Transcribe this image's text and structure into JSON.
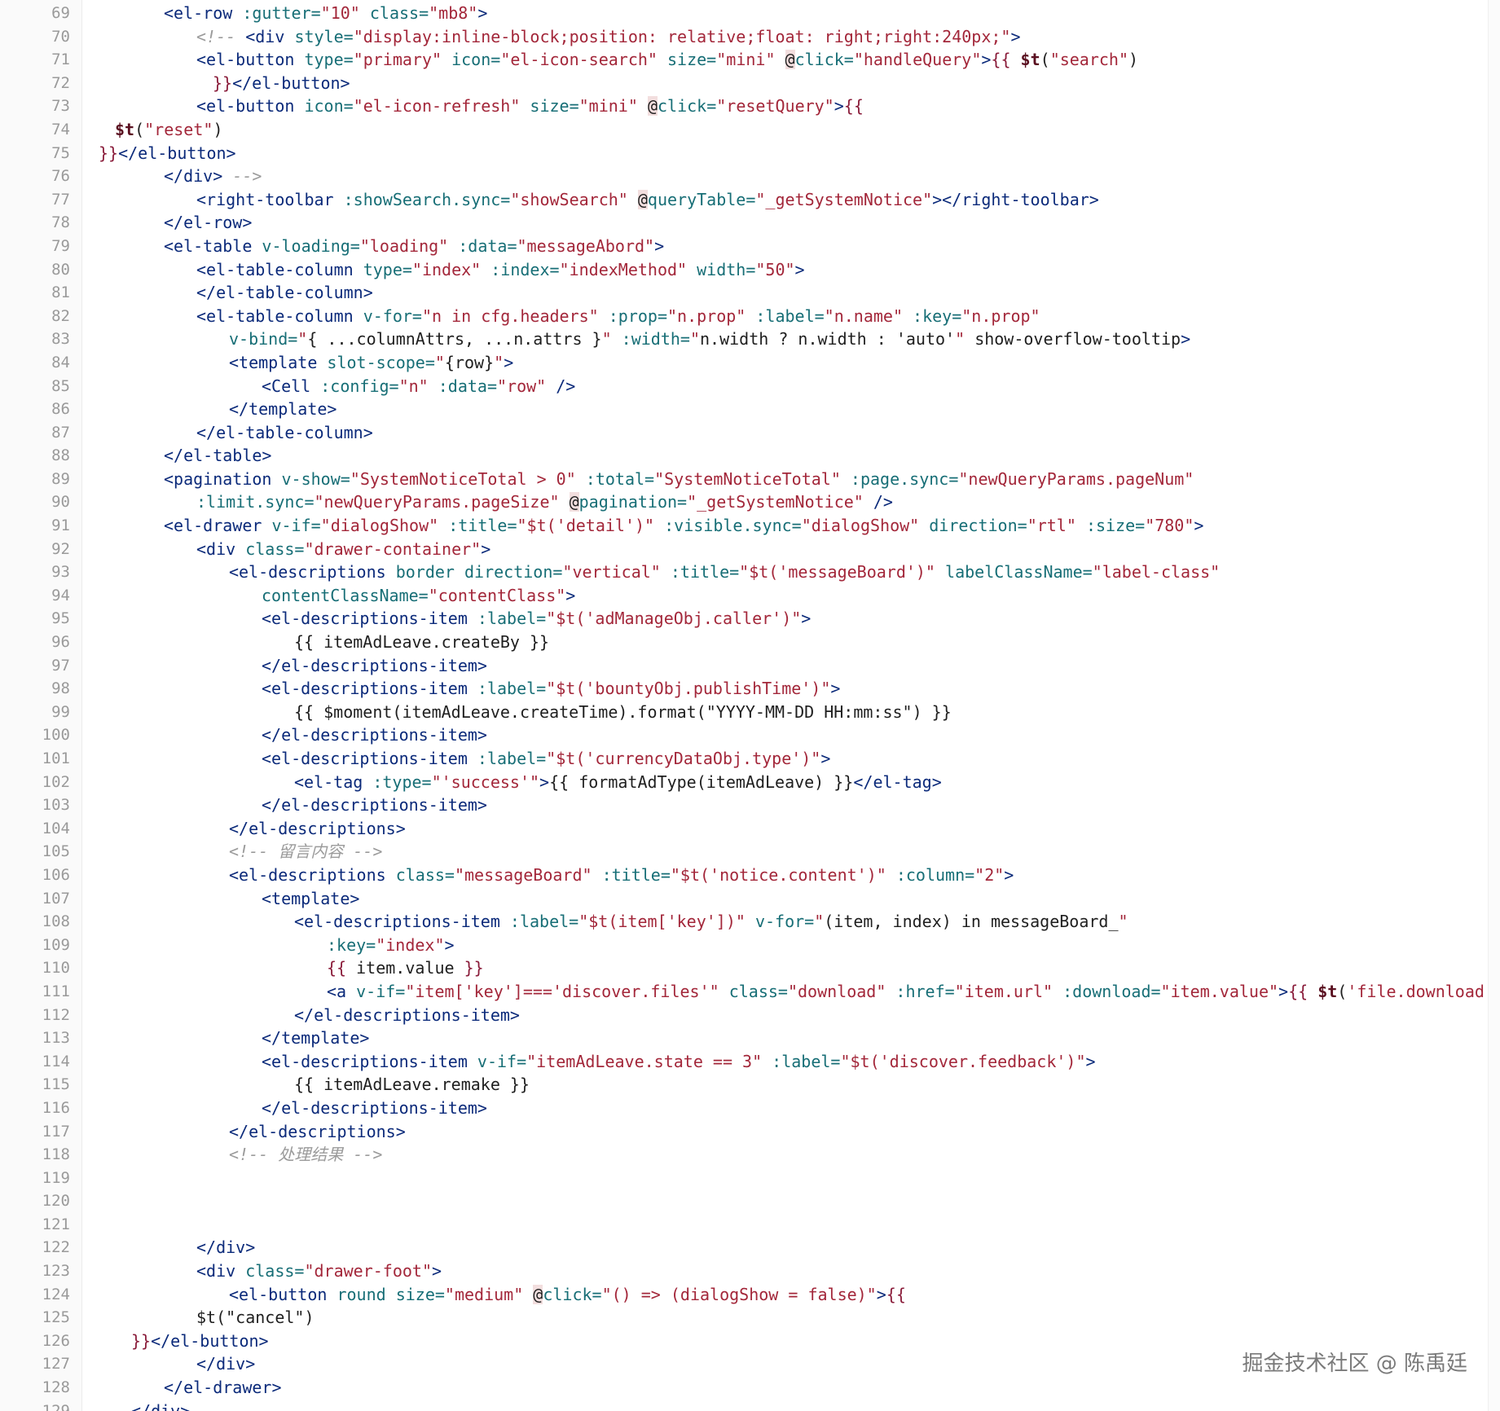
{
  "watermark": "掘金技术社区 @ 陈禹廷",
  "lines": [
    {
      "n": "69",
      "indent": 12,
      "toks": [
        [
          "tag",
          "<el-row "
        ],
        [
          "attr",
          ":gutter="
        ],
        [
          "str",
          "\"10\" "
        ],
        [
          "attr",
          "class="
        ],
        [
          "str",
          "\"mb8\""
        ],
        [
          "tag",
          ">"
        ]
      ]
    },
    {
      "n": "70",
      "indent": 16,
      "toks": [
        [
          "com",
          "<!-- "
        ],
        [
          "tag",
          "<div "
        ],
        [
          "attr",
          "style="
        ],
        [
          "str",
          "\"display:inline-block;position: relative;float: right;right:240px;\""
        ],
        [
          "tag",
          ">"
        ]
      ]
    },
    {
      "n": "71",
      "indent": 16,
      "toks": [
        [
          "tag",
          "<el-button "
        ],
        [
          "attr",
          "type="
        ],
        [
          "str",
          "\"primary\" "
        ],
        [
          "attr",
          "icon="
        ],
        [
          "str",
          "\"el-icon-search\" "
        ],
        [
          "attr",
          "size="
        ],
        [
          "str",
          "\"mini\" "
        ],
        [
          "at",
          "@"
        ],
        [
          "attr",
          "click="
        ],
        [
          "str",
          "\"handleQuery\""
        ],
        [
          "tag",
          ">"
        ],
        [
          "brk",
          "{{ "
        ],
        [
          "fn",
          "$t"
        ],
        [
          "txt",
          "("
        ],
        [
          "str",
          "\"search\""
        ],
        [
          "txt",
          ")"
        ]
      ]
    },
    {
      "n": "72",
      "indent": 18,
      "toks": [
        [
          "brk",
          "}}"
        ],
        [
          "tag",
          "</el-button>"
        ]
      ]
    },
    {
      "n": "73",
      "indent": 16,
      "toks": [
        [
          "tag",
          "<el-button "
        ],
        [
          "attr",
          "icon="
        ],
        [
          "str",
          "\"el-icon-refresh\" "
        ],
        [
          "attr",
          "size="
        ],
        [
          "str",
          "\"mini\" "
        ],
        [
          "at",
          "@"
        ],
        [
          "attr",
          "click="
        ],
        [
          "str",
          "\"resetQuery\""
        ],
        [
          "tag",
          ">"
        ],
        [
          "brk",
          "{{"
        ]
      ]
    },
    {
      "n": "74",
      "indent": 6,
      "toks": [
        [
          "fn",
          "$t"
        ],
        [
          "txt",
          "("
        ],
        [
          "str",
          "\"reset\""
        ],
        [
          "txt",
          ")"
        ]
      ]
    },
    {
      "n": "75",
      "indent": 4,
      "toks": [
        [
          "brk",
          "}}"
        ],
        [
          "tag",
          "</el-button>"
        ]
      ]
    },
    {
      "n": "76",
      "indent": 12,
      "toks": [
        [
          "tag",
          "</div> "
        ],
        [
          "com",
          "-->"
        ]
      ]
    },
    {
      "n": "77",
      "indent": 16,
      "toks": [
        [
          "tag",
          "<right-toolbar "
        ],
        [
          "attr",
          ":showSearch.sync="
        ],
        [
          "str",
          "\"showSearch\" "
        ],
        [
          "at",
          "@"
        ],
        [
          "attr",
          "queryTable="
        ],
        [
          "str",
          "\"_getSystemNotice\""
        ],
        [
          "tag",
          "></right-toolbar>"
        ]
      ]
    },
    {
      "n": "78",
      "indent": 12,
      "toks": [
        [
          "tag",
          "</el-row>"
        ]
      ]
    },
    {
      "n": "79",
      "indent": 12,
      "toks": [
        [
          "tag",
          "<el-table "
        ],
        [
          "attr",
          "v-loading="
        ],
        [
          "str",
          "\"loading\" "
        ],
        [
          "attr",
          ":data="
        ],
        [
          "str",
          "\"messageAbord\""
        ],
        [
          "tag",
          ">"
        ]
      ]
    },
    {
      "n": "80",
      "indent": 16,
      "toks": [
        [
          "tag",
          "<el-table-column "
        ],
        [
          "attr",
          "type="
        ],
        [
          "str",
          "\"index\" "
        ],
        [
          "attr",
          ":index="
        ],
        [
          "str",
          "\"indexMethod\" "
        ],
        [
          "attr",
          "width="
        ],
        [
          "str",
          "\"50\""
        ],
        [
          "tag",
          ">"
        ]
      ]
    },
    {
      "n": "81",
      "indent": 16,
      "toks": [
        [
          "tag",
          "</el-table-column>"
        ]
      ]
    },
    {
      "n": "82",
      "indent": 16,
      "toks": [
        [
          "tag",
          "<el-table-column "
        ],
        [
          "attr",
          "v-for="
        ],
        [
          "str",
          "\"n in cfg.headers\" "
        ],
        [
          "attr",
          ":prop="
        ],
        [
          "str",
          "\"n.prop\" "
        ],
        [
          "attr",
          ":label="
        ],
        [
          "str",
          "\"n.name\" "
        ],
        [
          "attr",
          ":key="
        ],
        [
          "str",
          "\"n.prop\""
        ]
      ]
    },
    {
      "n": "83",
      "indent": 20,
      "toks": [
        [
          "attr",
          "v-bind="
        ],
        [
          "str",
          "\""
        ],
        [
          "txt",
          "{ ...columnAttrs, ...n.attrs }"
        ],
        [
          "str",
          "\" "
        ],
        [
          "attr",
          ":width="
        ],
        [
          "str",
          "\""
        ],
        [
          "txt",
          "n.width ? n.width : 'auto'"
        ],
        [
          "str",
          "\" "
        ],
        [
          "txt",
          "show-overflow-tooltip"
        ],
        [
          "tag",
          ">"
        ]
      ]
    },
    {
      "n": "84",
      "indent": 20,
      "toks": [
        [
          "tag",
          "<template "
        ],
        [
          "attr",
          "slot-scope="
        ],
        [
          "str",
          "\""
        ],
        [
          "txt",
          "{row}"
        ],
        [
          "str",
          "\""
        ],
        [
          "tag",
          ">"
        ]
      ]
    },
    {
      "n": "85",
      "indent": 24,
      "toks": [
        [
          "tag",
          "<Cell "
        ],
        [
          "attr",
          ":config="
        ],
        [
          "str",
          "\"n\" "
        ],
        [
          "attr",
          ":data="
        ],
        [
          "str",
          "\"row\" "
        ],
        [
          "tag",
          "/>"
        ]
      ]
    },
    {
      "n": "86",
      "indent": 20,
      "toks": [
        [
          "tag",
          "</template>"
        ]
      ]
    },
    {
      "n": "87",
      "indent": 16,
      "toks": [
        [
          "tag",
          "</el-table-column>"
        ]
      ]
    },
    {
      "n": "88",
      "indent": 12,
      "toks": [
        [
          "tag",
          "</el-table>"
        ]
      ]
    },
    {
      "n": "89",
      "indent": 12,
      "toks": [
        [
          "tag",
          "<pagination "
        ],
        [
          "attr",
          "v-show="
        ],
        [
          "str",
          "\"SystemNoticeTotal > 0\" "
        ],
        [
          "attr",
          ":total="
        ],
        [
          "str",
          "\"SystemNoticeTotal\" "
        ],
        [
          "attr",
          ":page.sync="
        ],
        [
          "str",
          "\"newQueryParams.pageNum\""
        ]
      ]
    },
    {
      "n": "90",
      "indent": 16,
      "toks": [
        [
          "attr",
          ":limit.sync="
        ],
        [
          "str",
          "\"newQueryParams.pageSize\" "
        ],
        [
          "at",
          "@"
        ],
        [
          "attr",
          "pagination="
        ],
        [
          "str",
          "\"_getSystemNotice\" "
        ],
        [
          "tag",
          "/>"
        ]
      ]
    },
    {
      "n": "91",
      "indent": 12,
      "toks": [
        [
          "tag",
          "<el-drawer "
        ],
        [
          "attr",
          "v-if="
        ],
        [
          "str",
          "\"dialogShow\" "
        ],
        [
          "attr",
          ":title="
        ],
        [
          "str",
          "\"$t('detail')\" "
        ],
        [
          "attr",
          ":visible.sync="
        ],
        [
          "str",
          "\"dialogShow\" "
        ],
        [
          "attr",
          "direction="
        ],
        [
          "str",
          "\"rtl\" "
        ],
        [
          "attr",
          ":size="
        ],
        [
          "str",
          "\"780\""
        ],
        [
          "tag",
          ">"
        ]
      ]
    },
    {
      "n": "92",
      "indent": 16,
      "toks": [
        [
          "tag",
          "<div "
        ],
        [
          "attr",
          "class="
        ],
        [
          "str",
          "\"drawer-container\""
        ],
        [
          "tag",
          ">"
        ]
      ]
    },
    {
      "n": "93",
      "indent": 20,
      "toks": [
        [
          "tag",
          "<el-descriptions "
        ],
        [
          "attr",
          "border direction="
        ],
        [
          "str",
          "\"vertical\" "
        ],
        [
          "attr",
          ":title="
        ],
        [
          "str",
          "\"$t('messageBoard')\" "
        ],
        [
          "attr",
          "labelClassName="
        ],
        [
          "str",
          "\"label-class\""
        ]
      ]
    },
    {
      "n": "94",
      "indent": 24,
      "toks": [
        [
          "attr",
          "contentClassName="
        ],
        [
          "str",
          "\"contentClass\""
        ],
        [
          "tag",
          ">"
        ]
      ]
    },
    {
      "n": "95",
      "indent": 24,
      "toks": [
        [
          "tag",
          "<el-descriptions-item "
        ],
        [
          "attr",
          ":label="
        ],
        [
          "str",
          "\"$t('adManageObj.caller')\""
        ],
        [
          "tag",
          ">"
        ]
      ]
    },
    {
      "n": "96",
      "indent": 28,
      "toks": [
        [
          "txt",
          "{{ itemAdLeave.createBy }}"
        ]
      ]
    },
    {
      "n": "97",
      "indent": 24,
      "toks": [
        [
          "tag",
          "</el-descriptions-item>"
        ]
      ]
    },
    {
      "n": "98",
      "indent": 24,
      "toks": [
        [
          "tag",
          "<el-descriptions-item "
        ],
        [
          "attr",
          ":label="
        ],
        [
          "str",
          "\"$t('bountyObj.publishTime')\""
        ],
        [
          "tag",
          ">"
        ]
      ]
    },
    {
      "n": "99",
      "indent": 28,
      "toks": [
        [
          "txt",
          "{{ $moment(itemAdLeave.createTime).format(\"YYYY-MM-DD HH:mm:ss\") }}"
        ]
      ]
    },
    {
      "n": "100",
      "indent": 24,
      "toks": [
        [
          "tag",
          "</el-descriptions-item>"
        ]
      ]
    },
    {
      "n": "101",
      "indent": 24,
      "toks": [
        [
          "tag",
          "<el-descriptions-item "
        ],
        [
          "attr",
          ":label="
        ],
        [
          "str",
          "\"$t('currencyDataObj.type')\""
        ],
        [
          "tag",
          ">"
        ]
      ]
    },
    {
      "n": "102",
      "indent": 28,
      "toks": [
        [
          "tag",
          "<el-tag "
        ],
        [
          "attr",
          ":type="
        ],
        [
          "str",
          "\"'success'\""
        ],
        [
          "tag",
          ">"
        ],
        [
          "txt",
          "{{ formatAdType(itemAdLeave) }}"
        ],
        [
          "tag",
          "</el-tag>"
        ]
      ]
    },
    {
      "n": "103",
      "indent": 24,
      "toks": [
        [
          "tag",
          "</el-descriptions-item>"
        ]
      ]
    },
    {
      "n": "104",
      "indent": 20,
      "toks": [
        [
          "tag",
          "</el-descriptions>"
        ]
      ]
    },
    {
      "n": "105",
      "indent": 20,
      "toks": [
        [
          "com",
          "<!-- 留言内容 -->"
        ]
      ]
    },
    {
      "n": "106",
      "indent": 20,
      "toks": [
        [
          "tag",
          "<el-descriptions "
        ],
        [
          "attr",
          "class="
        ],
        [
          "str",
          "\"messageBoard\" "
        ],
        [
          "attr",
          ":title="
        ],
        [
          "str",
          "\"$t('notice.content')\" "
        ],
        [
          "attr",
          ":column="
        ],
        [
          "str",
          "\"2\""
        ],
        [
          "tag",
          ">"
        ]
      ]
    },
    {
      "n": "107",
      "indent": 24,
      "toks": [
        [
          "tag",
          "<template>"
        ]
      ]
    },
    {
      "n": "108",
      "indent": 28,
      "toks": [
        [
          "tag",
          "<el-descriptions-item "
        ],
        [
          "attr",
          ":label="
        ],
        [
          "str",
          "\"$t(item['key'])\" "
        ],
        [
          "attr",
          "v-for="
        ],
        [
          "str",
          "\""
        ],
        [
          "txt",
          "(item, index) in messageBoard_"
        ],
        [
          "str",
          "\""
        ]
      ]
    },
    {
      "n": "109",
      "indent": 32,
      "toks": [
        [
          "attr",
          ":key="
        ],
        [
          "str",
          "\"index\""
        ],
        [
          "tag",
          ">"
        ]
      ]
    },
    {
      "n": "110",
      "indent": 32,
      "toks": [
        [
          "brk",
          "{{ "
        ],
        [
          "txt",
          "item.value "
        ],
        [
          "brk",
          "}}"
        ]
      ]
    },
    {
      "n": "111",
      "indent": 32,
      "toks": [
        [
          "tag",
          "<a "
        ],
        [
          "attr",
          "v-if="
        ],
        [
          "str",
          "\"item['key']==='discover.files'\" "
        ],
        [
          "attr",
          "class="
        ],
        [
          "str",
          "\"download\" "
        ],
        [
          "attr",
          ":href="
        ],
        [
          "str",
          "\"item.url\" "
        ],
        [
          "attr",
          ":download="
        ],
        [
          "str",
          "\"item.value\""
        ],
        [
          "tag",
          ">"
        ],
        [
          "brk",
          "{{ "
        ],
        [
          "fn",
          "$t"
        ],
        [
          "txt",
          "("
        ],
        [
          "str",
          "'file.download"
        ]
      ]
    },
    {
      "n": "112",
      "indent": 28,
      "toks": [
        [
          "tag",
          "</el-descriptions-item>"
        ]
      ]
    },
    {
      "n": "113",
      "indent": 24,
      "toks": [
        [
          "tag",
          "</template>"
        ]
      ]
    },
    {
      "n": "114",
      "indent": 24,
      "toks": [
        [
          "tag",
          "<el-descriptions-item "
        ],
        [
          "attr",
          "v-if="
        ],
        [
          "str",
          "\"itemAdLeave.state == 3\" "
        ],
        [
          "attr",
          ":label="
        ],
        [
          "str",
          "\"$t('discover.feedback')\""
        ],
        [
          "tag",
          ">"
        ]
      ]
    },
    {
      "n": "115",
      "indent": 28,
      "toks": [
        [
          "txt",
          "{{ itemAdLeave.remake }}"
        ]
      ]
    },
    {
      "n": "116",
      "indent": 24,
      "toks": [
        [
          "tag",
          "</el-descriptions-item>"
        ]
      ]
    },
    {
      "n": "117",
      "indent": 20,
      "toks": [
        [
          "tag",
          "</el-descriptions>"
        ]
      ]
    },
    {
      "n": "118",
      "indent": 20,
      "toks": [
        [
          "com",
          "<!-- 处理结果 -->"
        ]
      ]
    },
    {
      "n": "119",
      "indent": 0,
      "toks": []
    },
    {
      "n": "120",
      "indent": 0,
      "toks": []
    },
    {
      "n": "121",
      "indent": 0,
      "toks": []
    },
    {
      "n": "122",
      "indent": 16,
      "toks": [
        [
          "tag",
          "</div>"
        ]
      ]
    },
    {
      "n": "123",
      "indent": 16,
      "toks": [
        [
          "tag",
          "<div "
        ],
        [
          "attr",
          "class="
        ],
        [
          "str",
          "\"drawer-foot\""
        ],
        [
          "tag",
          ">"
        ]
      ]
    },
    {
      "n": "124",
      "indent": 20,
      "toks": [
        [
          "tag",
          "<el-button "
        ],
        [
          "attr",
          "round size="
        ],
        [
          "str",
          "\"medium\" "
        ],
        [
          "at",
          "@"
        ],
        [
          "attr",
          "click="
        ],
        [
          "str",
          "\"() => (dialogShow = false)\""
        ],
        [
          "tag",
          ">"
        ],
        [
          "brk",
          "{{"
        ]
      ]
    },
    {
      "n": "125",
      "indent": 16,
      "toks": [
        [
          "txt",
          "$t(\"cancel\")"
        ]
      ]
    },
    {
      "n": "126",
      "indent": 8,
      "toks": [
        [
          "brk",
          "}}"
        ],
        [
          "tag",
          "</el-button>"
        ]
      ]
    },
    {
      "n": "127",
      "indent": 16,
      "toks": [
        [
          "tag",
          "</div>"
        ]
      ]
    },
    {
      "n": "128",
      "indent": 12,
      "toks": [
        [
          "tag",
          "</el-drawer>"
        ]
      ]
    },
    {
      "n": "129",
      "indent": 8,
      "toks": [
        [
          "tag",
          "</div>"
        ]
      ]
    }
  ]
}
